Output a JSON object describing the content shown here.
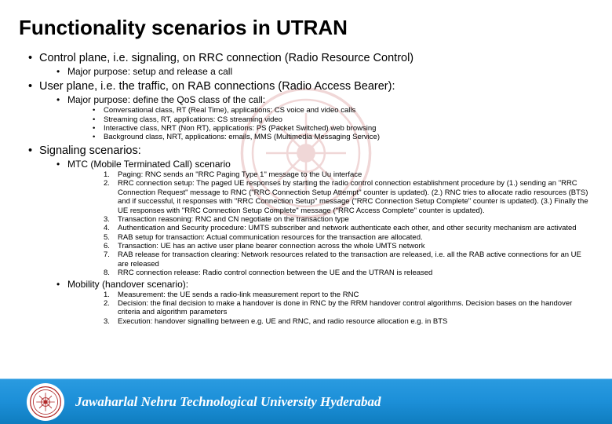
{
  "title": "Functionality scenarios in UTRAN",
  "sections": [
    {
      "text": "Control plane, i.e. signaling, on RRC connection (Radio Resource Control)",
      "sub": [
        {
          "text": "Major purpose: setup and release a call"
        }
      ]
    },
    {
      "text": "User plane, i.e. the traffic, on RAB connections (Radio Access Bearer):",
      "sub": [
        {
          "text": "Major purpose: define the QoS class of the call:",
          "sub": [
            {
              "text": "Conversational class, RT (Real Time), applications: CS voice and video calls"
            },
            {
              "text": "Streaming class, RT, applications: CS streaming video"
            },
            {
              "text": "Interactive class, NRT (Non RT), applications: PS (Packet Switched) web browsing"
            },
            {
              "text": "Background class, NRT, applications: emails, MMS (Multimedia Messaging Service)"
            }
          ]
        }
      ]
    },
    {
      "text": "Signaling scenarios:",
      "sub": [
        {
          "text": "MTC (Mobile Terminated Call) scenario",
          "numbered": [
            "Paging: RNC sends an \"RRC Paging Type 1\" message to the Uu interface",
            "RRC connection setup: The paged UE responses by starting the radio control connection establishment procedure by (1.) sending an \"RRC Connection Request\" message to RNC (\"RRC Connection Setup Attempt\" counter is updated). (2.) RNC tries to allocate radio resources (BTS) and if successful, it responses with \"RRC Connection Setup\" message (\"RRC Connection Setup Complete\" counter is updated). (3.) Finally the UE responses with \"RRC Connection Setup Complete\" message (\"RRC Access Complete\" counter is updated).",
            "Transaction reasoning: RNC and CN negotiate on the transaction type",
            "Authentication and Security procedure: UMTS subscriber and network authenticate each other, and other security mechanism are activated",
            "RAB setup for transaction: Actual communication resources for the transaction are allocated.",
            "Transaction: UE has an active user plane bearer connection across the whole UMTS network",
            "RAB release for transaction clearing: Network resources related to the transaction are released, i.e. all the RAB active connections for an UE are released",
            "RRC connection release: Radio control connection between the UE and the UTRAN is released"
          ]
        },
        {
          "text": "Mobility (handover scenario):",
          "numbered": [
            "Measurement: the UE sends a radio-link measurement report to the RNC",
            "Decision: the final decision to make a handover is done in RNC by the RRM handover control algorithms. Decision bases on the handover criteria and algorithm parameters",
            "Execution: handover signalling between e.g. UE and RNC, and radio resource allocation e.g. in BTS"
          ]
        }
      ]
    }
  ],
  "footer": {
    "text": "Jawaharlal Nehru Technological University Hyderabad"
  }
}
